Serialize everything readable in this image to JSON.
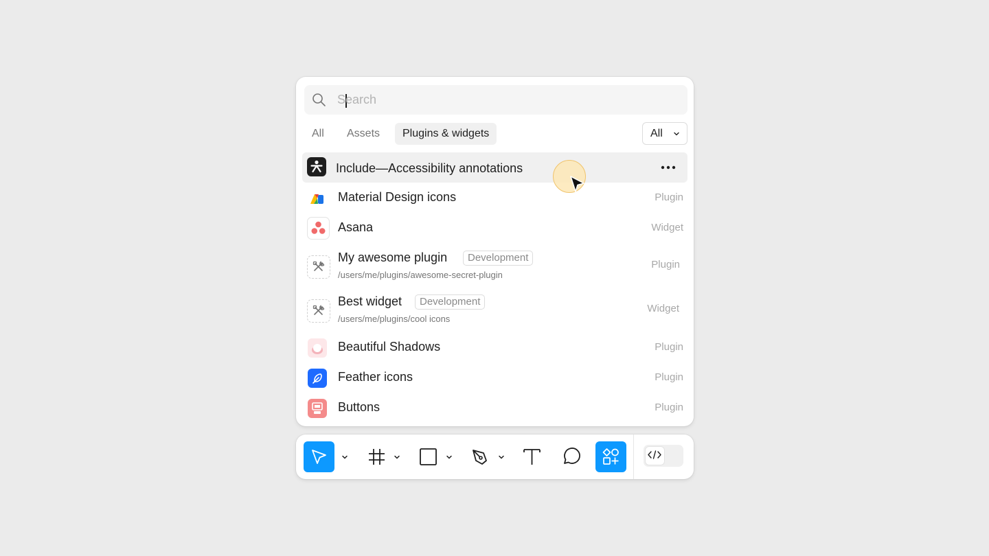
{
  "search": {
    "placeholder": "Search",
    "value": ""
  },
  "tabs": [
    {
      "label": "All",
      "active": false
    },
    {
      "label": "Assets",
      "active": false
    },
    {
      "label": "Plugins & widgets",
      "active": true
    }
  ],
  "filter": {
    "selected": "All"
  },
  "results": [
    {
      "name": "Include—Accessibility annotations",
      "type": "",
      "icon": "accessibility-icon",
      "highlighted": true
    },
    {
      "name": "Material Design icons",
      "type": "Plugin",
      "icon": "material-design-icon"
    },
    {
      "name": "Asana",
      "type": "Widget",
      "icon": "asana-icon"
    },
    {
      "name": "My awesome plugin",
      "type": "Plugin",
      "icon": "dev-tools-icon",
      "badge": "Development",
      "path": "/users/me/plugins/awesome-secret-plugin"
    },
    {
      "name": "Best widget",
      "type": "Widget",
      "icon": "dev-tools-icon",
      "badge": "Development",
      "path": "/users/me/plugins/cool icons"
    },
    {
      "name": "Beautiful Shadows",
      "type": "Plugin",
      "icon": "beautiful-shadows-icon"
    },
    {
      "name": "Feather icons",
      "type": "Plugin",
      "icon": "feather-icon"
    },
    {
      "name": "Buttons",
      "type": "Plugin",
      "icon": "buttons-icon"
    }
  ],
  "toolbar": {
    "tools": [
      {
        "name": "move-tool",
        "icon": "cursor-arrow-icon",
        "active": true
      },
      {
        "name": "frame-tool",
        "icon": "hash-frame-icon",
        "active": false
      },
      {
        "name": "shape-tool",
        "icon": "rectangle-icon",
        "active": false
      },
      {
        "name": "pen-tool",
        "icon": "pen-icon",
        "active": false
      },
      {
        "name": "text-tool",
        "icon": "text-icon",
        "active": false
      },
      {
        "name": "comment-tool",
        "icon": "comment-icon",
        "active": false
      },
      {
        "name": "actions-tool",
        "icon": "shapes-plus-icon",
        "active": true
      }
    ],
    "dev_mode_icon": "code-icon"
  },
  "colors": {
    "accent": "#0d99ff",
    "background": "#ebebeb",
    "panel": "#ffffff",
    "highlight_row": "#f0f0f0",
    "cursor_halo": "#fde8b6",
    "asana": "#f06a6a",
    "feather": "#1e6bff",
    "buttons": "#f24e4e"
  }
}
